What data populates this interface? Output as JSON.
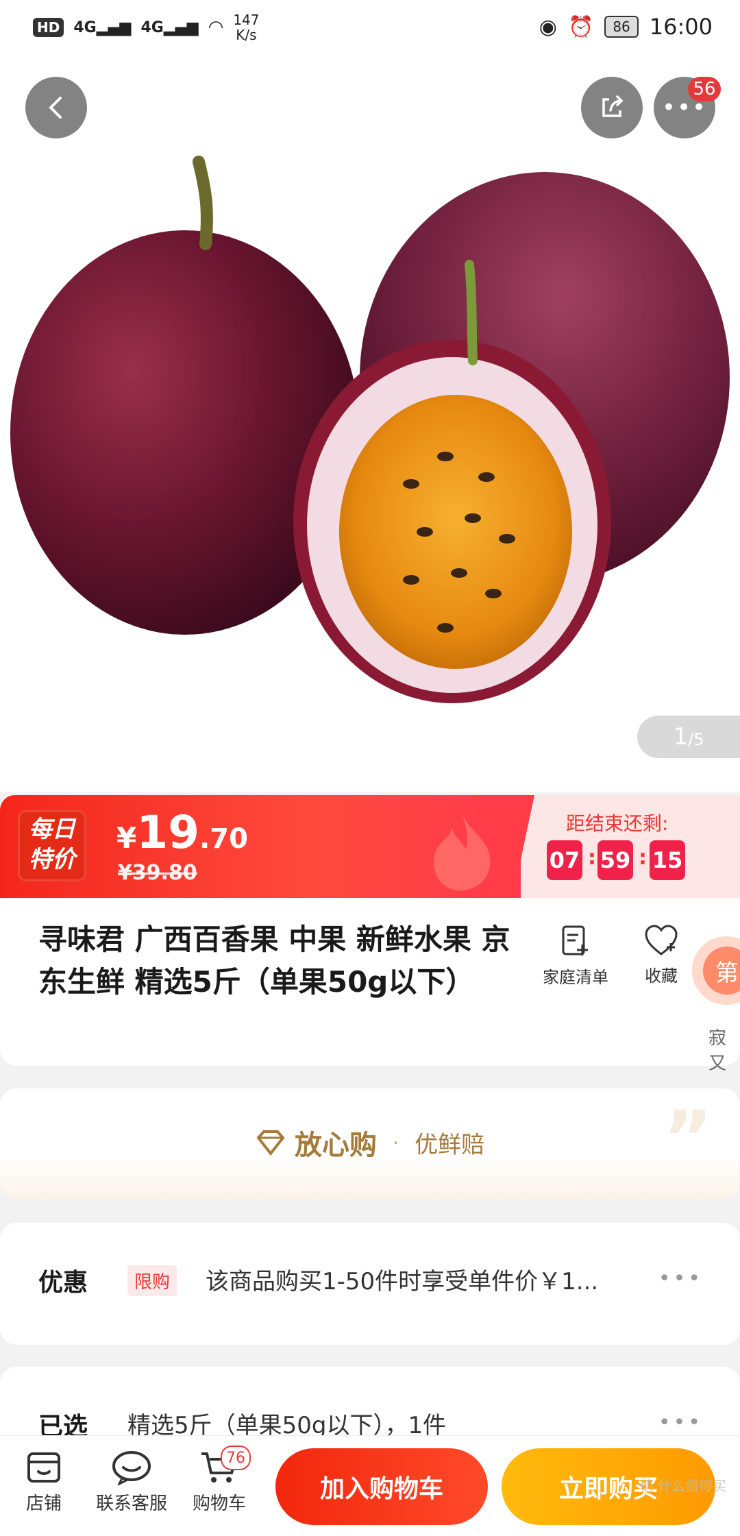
{
  "status_bar": {
    "hd": "HD",
    "net1": "4G",
    "net2": "4G",
    "speed_value": "147",
    "speed_unit": "K/s",
    "battery": "86",
    "time": "16:00"
  },
  "header": {
    "more_badge": "56"
  },
  "gallery": {
    "current": "1",
    "total": "/5"
  },
  "price": {
    "badge_line1": "每日",
    "badge_line2": "特价",
    "currency": "¥",
    "integer": "19",
    "decimal": ".70",
    "original": "¥39.80",
    "countdown_label": "距结束还剩:",
    "hours": "07",
    "minutes": "59",
    "seconds": "15",
    "sep": ":"
  },
  "product": {
    "title": "寻味君 广西百香果 中果 新鲜水果 京东生鲜 精选5斤（单果50g以下）",
    "family_list_label": "家庭清单",
    "favorite_label": "收藏",
    "float_chip": "第",
    "float_text": "寂又"
  },
  "assurance": {
    "main": "放心购",
    "separator": "·",
    "sub": "优鲜赔",
    "quote": "”"
  },
  "promo": {
    "label": "优惠",
    "tag": "限购",
    "text": "该商品购买1-50件时享受单件价￥1...",
    "dots": "•••"
  },
  "selected": {
    "label": "已选",
    "text": "精选5斤（单果50g以下），1件",
    "dots": "•••"
  },
  "bottom_bar": {
    "store": "店铺",
    "service": "联系客服",
    "cart": "购物车",
    "cart_badge": "76",
    "add_to_cart": "加入购物车",
    "buy_now": "立即购买"
  },
  "watermark": "值 什么值得买",
  "colors": {
    "accent_red": "#e4393c",
    "price_red": "#f4261c",
    "buy_orange": "#ff9a00",
    "gold": "#a57a3a"
  }
}
